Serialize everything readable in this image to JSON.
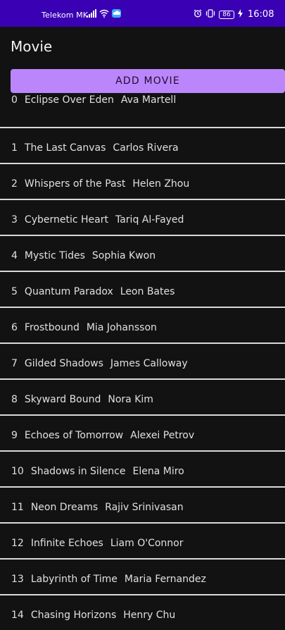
{
  "status_bar": {
    "carrier": "Telekom MK",
    "battery": "86",
    "time": "16:08",
    "icons": [
      "signal-icon",
      "wifi-icon",
      "cloud-icon",
      "alarm-icon",
      "vibrate-icon",
      "battery-icon",
      "charging-icon"
    ],
    "background": "#3a00b3"
  },
  "app_bar": {
    "title": "Movie"
  },
  "toolbar": {
    "add_label": "ADD MOVIE",
    "accent": "#bb86fc"
  },
  "movies": [
    {
      "index": "0",
      "title": "Eclipse Over Eden",
      "director": "Ava Martell"
    },
    {
      "index": "1",
      "title": "The Last Canvas",
      "director": "Carlos Rivera"
    },
    {
      "index": "2",
      "title": "Whispers of the Past",
      "director": "Helen Zhou"
    },
    {
      "index": "3",
      "title": "Cybernetic Heart",
      "director": "Tariq Al-Fayed"
    },
    {
      "index": "4",
      "title": "Mystic Tides",
      "director": "Sophia Kwon"
    },
    {
      "index": "5",
      "title": "Quantum Paradox",
      "director": "Leon Bates"
    },
    {
      "index": "6",
      "title": "Frostbound",
      "director": "Mia Johansson"
    },
    {
      "index": "7",
      "title": "Gilded Shadows",
      "director": "James Calloway"
    },
    {
      "index": "8",
      "title": "Skyward Bound",
      "director": "Nora Kim"
    },
    {
      "index": "9",
      "title": "Echoes of Tomorrow",
      "director": "Alexei Petrov"
    },
    {
      "index": "10",
      "title": "Shadows in Silence",
      "director": "Elena Miro"
    },
    {
      "index": "11",
      "title": "Neon Dreams",
      "director": "Rajiv Srinivasan"
    },
    {
      "index": "12",
      "title": "Infinite Echoes",
      "director": "Liam O'Connor"
    },
    {
      "index": "13",
      "title": "Labyrinth of Time",
      "director": "Maria Fernandez"
    },
    {
      "index": "14",
      "title": "Chasing Horizons",
      "director": "Henry Chu"
    }
  ]
}
